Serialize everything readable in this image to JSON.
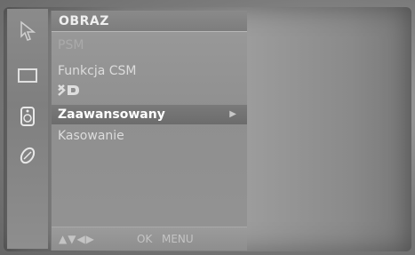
{
  "menu": {
    "title": "OBRAZ",
    "items": [
      {
        "label": "PSM",
        "faint": true
      },
      {
        "label": "Funkcja CSM"
      },
      {
        "label": "XD",
        "logo": true
      },
      {
        "label": "Zaawansowany",
        "selected": true,
        "has_submenu": true
      },
      {
        "label": "Kasowanie"
      }
    ],
    "footer": {
      "nav_arrows": "▲▼◀▶",
      "ok_label": "OK",
      "menu_label": "MENU"
    }
  },
  "sidebar": {
    "icons": [
      "picture-icon",
      "screen-icon",
      "sound-icon",
      "settings-icon"
    ]
  },
  "colors": {
    "selected_bg": "#707070",
    "panel_bg": "#959595",
    "text": "#dcdcdc"
  }
}
